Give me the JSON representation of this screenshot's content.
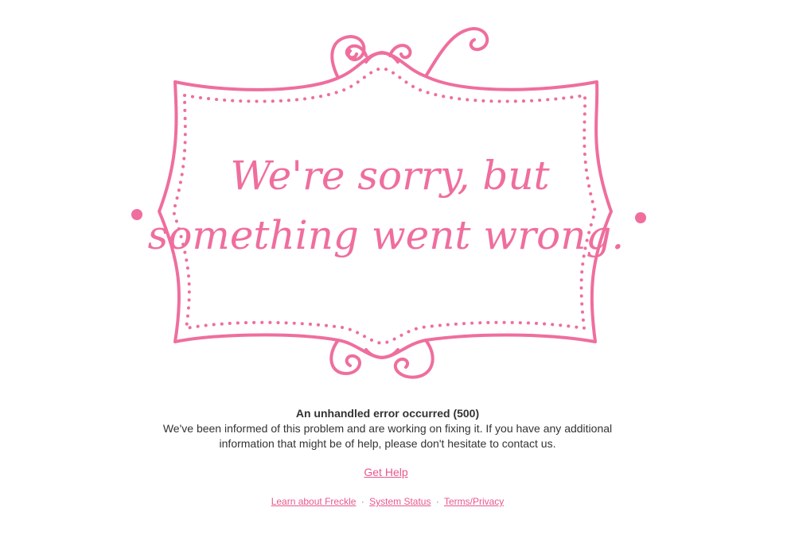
{
  "banner": {
    "line1": "We're sorry, but",
    "line2": "something went wrong."
  },
  "error": {
    "title": "An unhandled error occurred (500)",
    "body_line1": "We've been informed of this problem and are working on fixing it. If you have any additional",
    "body_line2": "information that might be of help, please don't hesitate to contact us."
  },
  "help_link": "Get Help",
  "footer": {
    "links": [
      "Learn about Freckle",
      "System Status",
      "Terms/Privacy"
    ],
    "separator": "·"
  },
  "colors": {
    "accent": "#ef6e9e",
    "link": "#e9578c",
    "text": "#333333"
  }
}
